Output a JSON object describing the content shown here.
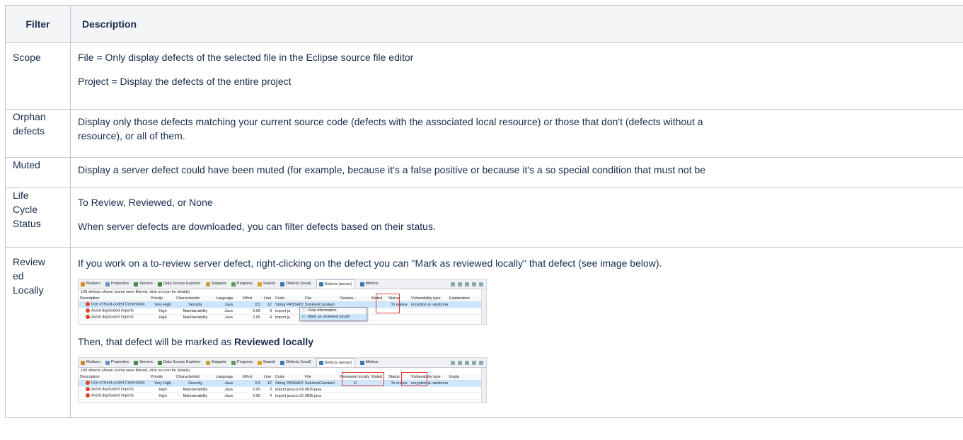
{
  "table": {
    "headers": [
      "Filter",
      "Description"
    ],
    "rows": {
      "scope": {
        "name": "Scope",
        "p1": "File = Only display defects of the selected file in the Eclipse source file editor",
        "p2": "Project = Display the defects of the entire project"
      },
      "orphan": {
        "name_line1": "Orphan",
        "name_line2": "defects",
        "p1_line1": "Display only those defects matching your current source code (defects with the associated local resource) or those that don't (defects without a",
        "p1_line2": "resource), or all of them."
      },
      "muted": {
        "name": "Muted",
        "p1": "Display a server defect could have been muted (for example, because it's a false positive or because it's a so special condition that must not be"
      },
      "life": {
        "name_line1": "Life",
        "name_line2": "Cycle",
        "name_line3": "Status",
        "p1": "To Review, Reviewed, or None",
        "p2": "When server defects are downloaded, you can filter defects based on their status."
      },
      "review": {
        "name_line1": "Review",
        "name_line2": "ed",
        "name_line3": "Locally",
        "p1": "If you work on a to-review server defect, right-clicking on the defect you can \"Mark as reviewed locally\" that defect (see image below).",
        "p2_prefix": "Then, that defect will be marked as ",
        "p2_bold": "Reviewed locally"
      }
    }
  },
  "screenshot": {
    "tabs": [
      "Markers",
      "Properties",
      "Servers",
      "Data Source Explorer",
      "Snippets",
      "Progress",
      "Search",
      "Defects (local)",
      "Defects (server)",
      "Metrics"
    ],
    "info": "100 defects shown (some were filtered, click on icon for details)",
    "columns1": [
      "Description",
      "Priority",
      "Characteristic",
      "Language",
      "Effort",
      "Line",
      "Code",
      "File",
      "Review...",
      "Muted",
      "Status",
      "Vulnerability type",
      "Explanation"
    ],
    "columns2": [
      "Description",
      "Priority",
      "Characteristic",
      "Language",
      "Effort",
      "Line",
      "Code",
      "File",
      "Reviewed locally",
      "Muted",
      "Status",
      "Vulnerability type",
      "Expla"
    ],
    "rows1": [
      [
        "Use of Hard-coded Credentials",
        "Very High",
        "Security",
        "Java",
        "0.5",
        "12",
        "String PASSWORD",
        "SolutionConstant",
        "",
        "",
        "To review",
        "ncryption & randomnes",
        ""
      ],
      [
        "Avoid duplicated imports",
        "High",
        "Maintainability",
        "Java",
        "0.05",
        "3",
        "import ja",
        "",
        "",
        "",
        "",
        "",
        ""
      ],
      [
        "Avoid duplicated imports",
        "High",
        "Maintainability",
        "Java",
        "0.05",
        "4",
        "import ja",
        "",
        "",
        "",
        "",
        "",
        ""
      ]
    ],
    "rows2": [
      [
        "Use of Hard-coded Credentials",
        "Very High",
        "Security",
        "Java",
        "0.5",
        "12",
        "String PASSWORD",
        "SolutionConstant",
        "☑",
        "",
        "To review",
        "ncryption & randomnes",
        ""
      ],
      [
        "Avoid duplicated imports",
        "High",
        "Maintainability",
        "Java",
        "0.05",
        "3",
        "import java.io.File",
        "MD5.java",
        "",
        "",
        "",
        "",
        ""
      ],
      [
        "Avoid duplicated imports",
        "High",
        "Maintainability",
        "Java",
        "0.05",
        "4",
        "import java.io.IOE",
        "MD5.java",
        "",
        "",
        "",
        "",
        ""
      ]
    ],
    "context_menu": [
      "Rule information",
      "Mark as reviewed locally"
    ],
    "colors": {
      "selected_row": "#cce6ff",
      "highlight_box": "#e03a3a",
      "defect_icon": "#e0442b"
    }
  }
}
